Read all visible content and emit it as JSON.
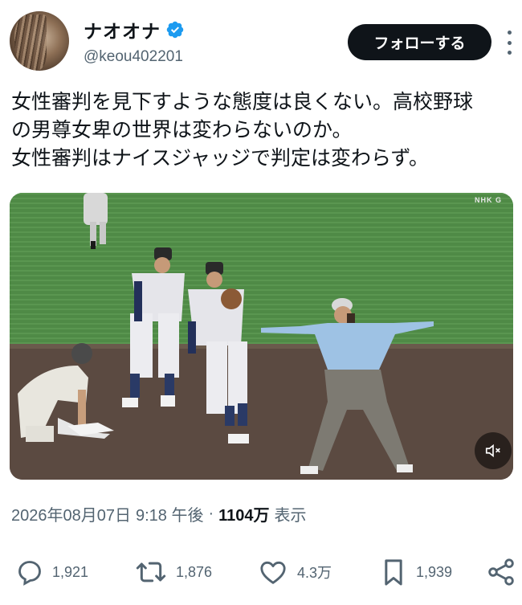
{
  "author": {
    "display_name": "ナオオナ",
    "handle": "@keou402201",
    "verified_icon": "verified-badge-icon"
  },
  "follow_button": {
    "label": "フォローする"
  },
  "tweet": {
    "lines": [
      "女性審判を見下すような態度は良くない。高校野球",
      "の男尊女卑の世界は変わらないのか。",
      "女性審判はナイスジャッジで判定は変わらず。"
    ]
  },
  "media": {
    "watermark": "NHK G",
    "mute_icon": "volume-muted-icon"
  },
  "meta": {
    "date": "2026年08月07日",
    "time": "9:18 午後",
    "separator": "·",
    "views_count": "1104万",
    "views_label": "表示"
  },
  "actions": {
    "replies": "1,921",
    "reposts": "1,876",
    "likes": "4.3万",
    "bookmarks": "1,939"
  },
  "colors": {
    "text_primary": "#0f1419",
    "text_secondary": "#536471",
    "verified_blue": "#1d9bf0",
    "follow_bg": "#0f1419"
  }
}
